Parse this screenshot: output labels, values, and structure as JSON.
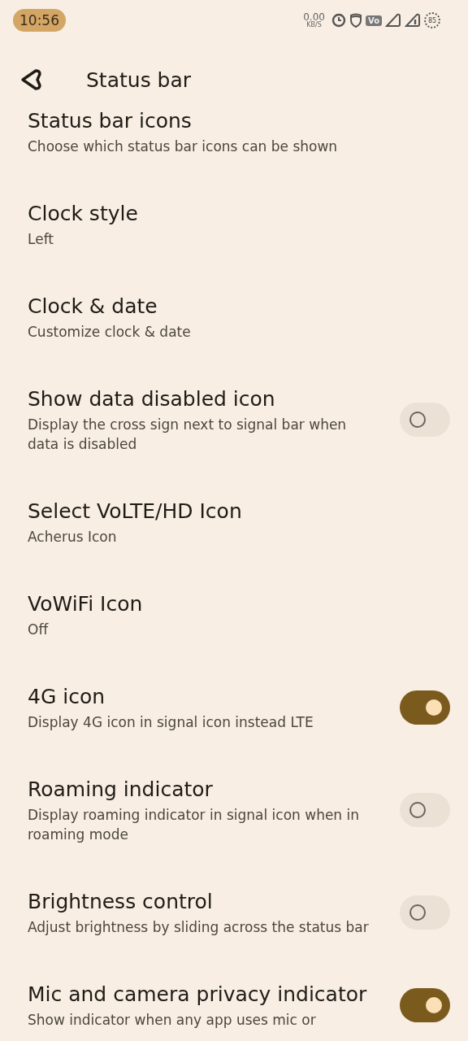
{
  "status_bar": {
    "time": "10:56",
    "net_speed": "0.00",
    "net_unit": "KB/S",
    "vo_badge": "Vo",
    "battery": "85"
  },
  "header": {
    "title": "Status bar"
  },
  "settings": [
    {
      "title": "Status bar icons",
      "subtitle": "Choose which status bar icons can be shown",
      "kind": "link"
    },
    {
      "title": "Clock style",
      "subtitle": "Left",
      "kind": "link"
    },
    {
      "title": "Clock & date",
      "subtitle": "Customize clock & date",
      "kind": "link"
    },
    {
      "title": "Show data disabled icon",
      "subtitle": "Display the cross sign next to signal bar when data is disabled",
      "kind": "toggle",
      "on": false
    },
    {
      "title": "Select VoLTE/HD Icon",
      "subtitle": "Acherus Icon",
      "kind": "link"
    },
    {
      "title": "VoWiFi Icon",
      "subtitle": "Off",
      "kind": "link"
    },
    {
      "title": "4G icon",
      "subtitle": "Display 4G icon in signal icon instead LTE",
      "kind": "toggle",
      "on": true
    },
    {
      "title": "Roaming indicator",
      "subtitle": "Display roaming indicator in signal icon when in roaming mode",
      "kind": "toggle",
      "on": false
    },
    {
      "title": "Brightness control",
      "subtitle": "Adjust brightness by sliding across the status bar",
      "kind": "toggle",
      "on": false
    },
    {
      "title": "Mic and camera privacy indicator",
      "subtitle": "Show indicator when any app uses mic or",
      "kind": "toggle",
      "on": true
    }
  ]
}
